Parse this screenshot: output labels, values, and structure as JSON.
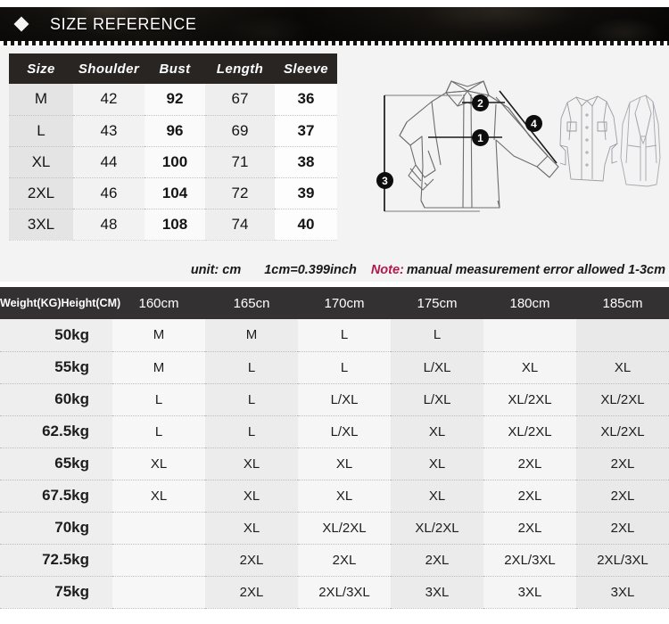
{
  "banner": {
    "title": "SIZE REFERENCE",
    "bullet_icon": "diamond-icon"
  },
  "size_table": {
    "headers": [
      "Size",
      "Shoulder",
      "Bust",
      "Length",
      "Sleeve"
    ],
    "rows": [
      {
        "size": "M",
        "shoulder": "42",
        "bust": "92",
        "length": "67",
        "sleeve": "36"
      },
      {
        "size": "L",
        "shoulder": "43",
        "bust": "96",
        "length": "69",
        "sleeve": "37"
      },
      {
        "size": "XL",
        "shoulder": "44",
        "bust": "100",
        "length": "71",
        "sleeve": "38"
      },
      {
        "size": "2XL",
        "shoulder": "46",
        "bust": "104",
        "length": "72",
        "sleeve": "39"
      },
      {
        "size": "3XL",
        "shoulder": "48",
        "bust": "108",
        "length": "74",
        "sleeve": "40"
      }
    ]
  },
  "note": {
    "unit": "unit: cm",
    "conversion": "1cm=0.399inch",
    "note_label": "Note:",
    "note_text": "manual measurement error allowed 1-3cm",
    "note_color": "#b2194a"
  },
  "figure": {
    "badges": [
      {
        "label": "1",
        "name": "bust-marker"
      },
      {
        "label": "2",
        "name": "shoulder-marker"
      },
      {
        "label": "3",
        "name": "length-marker"
      },
      {
        "label": "4",
        "name": "sleeve-marker"
      }
    ]
  },
  "weight_table": {
    "headers": [
      "Weight(KG)Height(CM)",
      "160cm",
      "165cn",
      "170cm",
      "175cm",
      "180cm",
      "185cm"
    ],
    "rows": [
      {
        "weight": "50kg",
        "cells": [
          "M",
          "M",
          "L",
          "L",
          "",
          ""
        ]
      },
      {
        "weight": "55kg",
        "cells": [
          "M",
          "L",
          "L",
          "L/XL",
          "XL",
          "XL"
        ]
      },
      {
        "weight": "60kg",
        "cells": [
          "L",
          "L",
          "L/XL",
          "L/XL",
          "XL/2XL",
          "XL/2XL"
        ]
      },
      {
        "weight": "62.5kg",
        "cells": [
          "L",
          "L",
          "L/XL",
          "XL",
          "XL/2XL",
          "XL/2XL"
        ]
      },
      {
        "weight": "65kg",
        "cells": [
          "XL",
          "XL",
          "XL",
          "XL",
          "2XL",
          "2XL"
        ]
      },
      {
        "weight": "67.5kg",
        "cells": [
          "XL",
          "XL",
          "XL",
          "XL",
          "2XL",
          "2XL"
        ]
      },
      {
        "weight": "70kg",
        "cells": [
          "",
          "XL",
          "XL/2XL",
          "XL/2XL",
          "2XL",
          "2XL"
        ]
      },
      {
        "weight": "72.5kg",
        "cells": [
          "",
          "2XL",
          "2XL",
          "2XL",
          "2XL/3XL",
          "2XL/3XL"
        ]
      },
      {
        "weight": "75kg",
        "cells": [
          "",
          "2XL",
          "2XL/3XL",
          "3XL",
          "3XL",
          "3XL"
        ]
      }
    ]
  }
}
